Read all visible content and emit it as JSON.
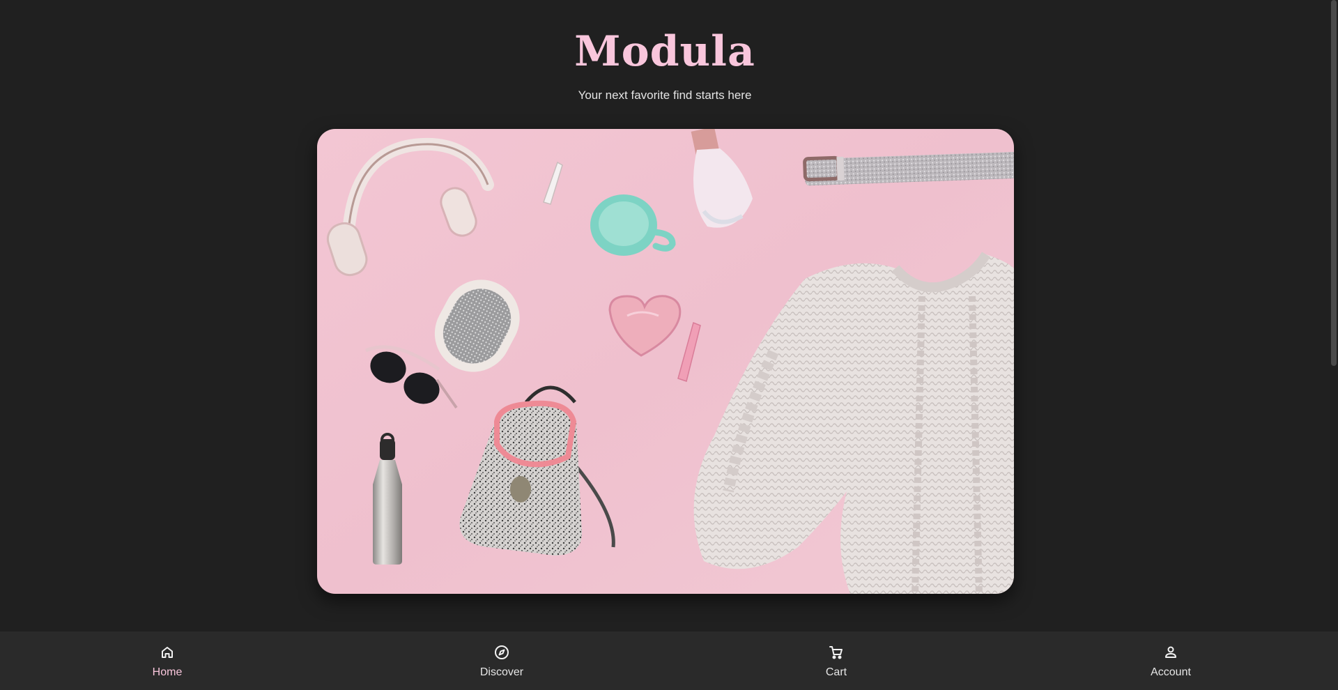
{
  "header": {
    "brand": "Modula",
    "tagline": "Your next favorite find starts here"
  },
  "hero": {
    "image_subject": "flat-lay of pink accessories and a white cable-knit sweater"
  },
  "bottom_nav": {
    "items": [
      {
        "label": "Home",
        "icon": "home-icon",
        "active": true
      },
      {
        "label": "Discover",
        "icon": "compass-icon",
        "active": false
      },
      {
        "label": "Cart",
        "icon": "cart-icon",
        "active": false
      },
      {
        "label": "Account",
        "icon": "person-icon",
        "active": false
      }
    ]
  },
  "colors": {
    "background": "#202020",
    "nav_background": "#2a2a2a",
    "brand": "#f9c6dc",
    "hero_backdrop": "#f0c4d1"
  }
}
